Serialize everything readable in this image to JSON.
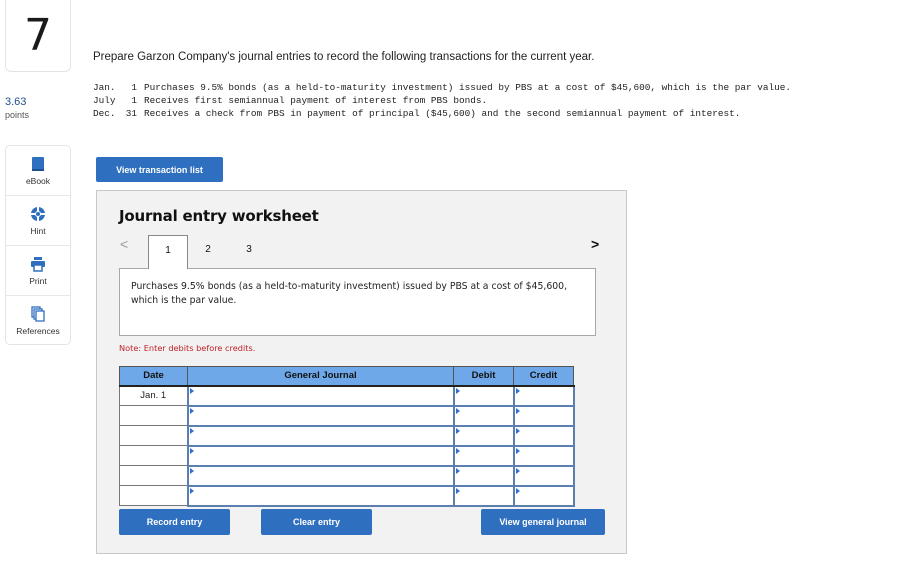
{
  "question": {
    "number": "7",
    "points_value": "3.63",
    "points_label": "points"
  },
  "tools": [
    {
      "label": "eBook",
      "icon": "book-icon"
    },
    {
      "label": "Hint",
      "icon": "lifebuoy-icon"
    },
    {
      "label": "Print",
      "icon": "printer-icon"
    },
    {
      "label": "References",
      "icon": "documents-icon"
    }
  ],
  "prompt": "Prepare Garzon Company's journal entries to record the following transactions for the current year.",
  "transactions": [
    {
      "month": "Jan.",
      "day": "1",
      "description": "Purchases 9.5% bonds (as a held-to-maturity investment) issued by PBS at a cost of $45,600, which is the par value."
    },
    {
      "month": "July",
      "day": "1",
      "description": "Receives first semiannual payment of interest from PBS bonds."
    },
    {
      "month": "Dec.",
      "day": "31",
      "description": "Receives a check from PBS in payment of principal ($45,600) and the second semiannual payment of interest."
    }
  ],
  "buttons": {
    "view_transaction_list": "View transaction list",
    "record_entry": "Record entry",
    "clear_entry": "Clear entry",
    "view_general_journal": "View general journal"
  },
  "worksheet": {
    "title": "Journal entry worksheet",
    "prev_symbol": "<",
    "next_symbol": ">",
    "tabs": [
      "1",
      "2",
      "3"
    ],
    "active_tab": "1",
    "description": "Purchases 9.5% bonds (as a held-to-maturity investment) issued by PBS at a cost of $45,600, which is the par value.",
    "note": "Note: Enter debits before credits.",
    "columns": [
      "Date",
      "General Journal",
      "Debit",
      "Credit"
    ],
    "rows": [
      {
        "date": "Jan. 1",
        "account": "",
        "debit": "",
        "credit": ""
      },
      {
        "date": "",
        "account": "",
        "debit": "",
        "credit": ""
      },
      {
        "date": "",
        "account": "",
        "debit": "",
        "credit": ""
      },
      {
        "date": "",
        "account": "",
        "debit": "",
        "credit": ""
      },
      {
        "date": "",
        "account": "",
        "debit": "",
        "credit": ""
      },
      {
        "date": "",
        "account": "",
        "debit": "",
        "credit": ""
      }
    ]
  },
  "colors": {
    "brand_blue": "#2f6fbf",
    "header_blue": "#6ea8e8",
    "note_red": "#c0222a",
    "points_blue": "#1f4f8f"
  }
}
